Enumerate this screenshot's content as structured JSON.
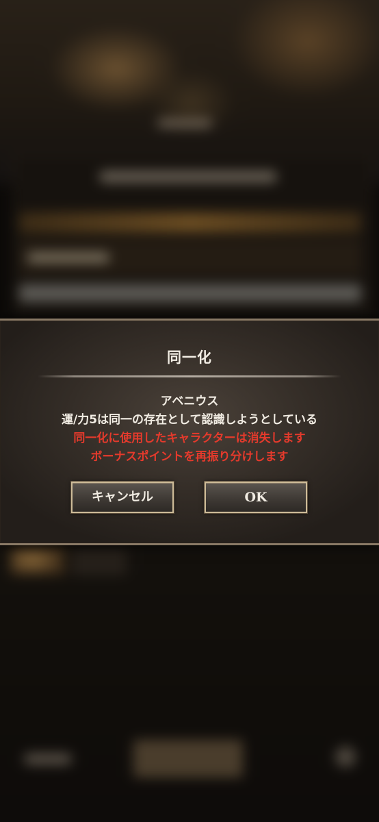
{
  "dialog": {
    "title": "同一化",
    "lines": [
      {
        "text": "アベニウス",
        "color": "#f1ece3"
      },
      {
        "text": "運/力5は同一の存在として認識しようとしている",
        "color": "#f1ece3"
      },
      {
        "text": "同一化に使用したキャラクターは消失します",
        "color": "#e53a2c"
      },
      {
        "text": "ボーナスポイントを再振り分けします",
        "color": "#e53a2c"
      }
    ],
    "cancel_label": "キャンセル",
    "ok_label": "OK"
  },
  "colors": {
    "warning": "#e53a2c",
    "text": "#f1ece3",
    "button_border": "#cdbb98"
  }
}
